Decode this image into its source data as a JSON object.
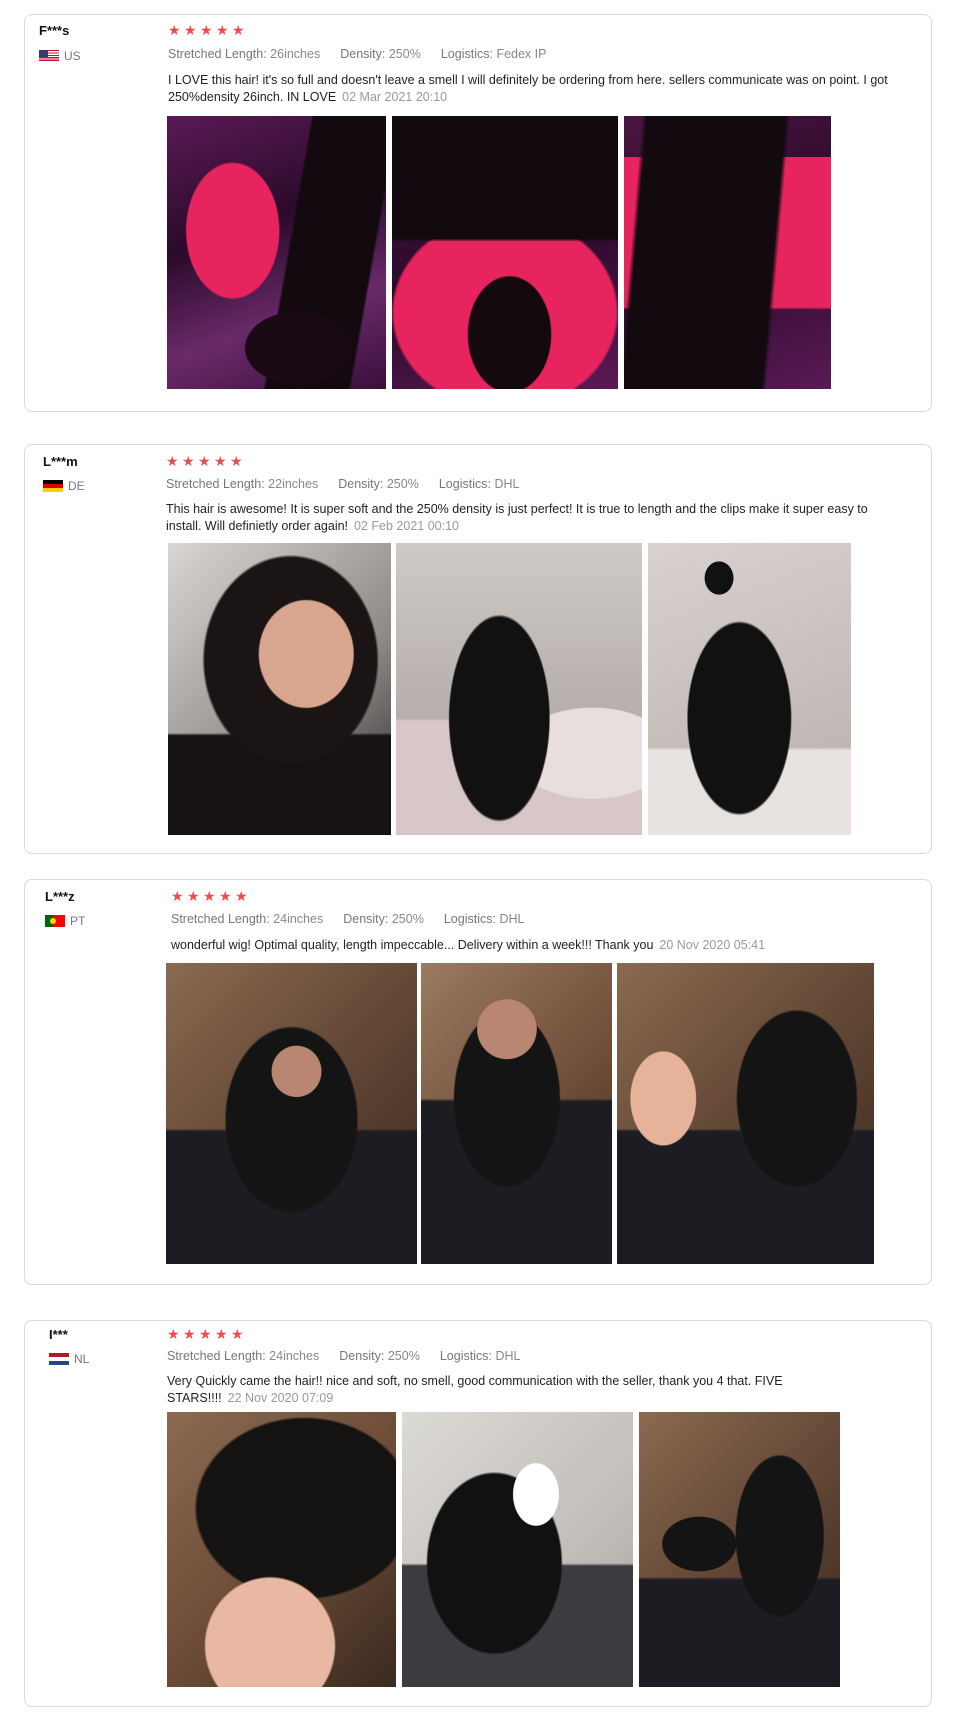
{
  "reviews": [
    {
      "user": "F***s",
      "country": "US",
      "flag": "us-flag-icon",
      "rating": 5,
      "attributes": [
        {
          "label": "Stretched Length:",
          "value": "26inches"
        },
        {
          "label": "Density:",
          "value": "250%"
        },
        {
          "label": "Logistics:",
          "value": "Fedex IP"
        }
      ],
      "text": "I LOVE this hair! it's so full and doesn't leave a smell I will definitely be ordering from here. sellers communicate was on point. I got 250%density 26inch. IN LOVE",
      "date": "02 Mar 2021 20:10",
      "photos": [
        "hair-bundle-photo",
        "hair-bundle-photo",
        "hair-bundle-photo"
      ]
    },
    {
      "user": "L***m",
      "country": "DE",
      "flag": "de-flag-icon",
      "rating": 5,
      "attributes": [
        {
          "label": "Stretched Length:",
          "value": "22inches"
        },
        {
          "label": "Density:",
          "value": "250%"
        },
        {
          "label": "Logistics:",
          "value": "DHL"
        }
      ],
      "text": "This hair is awesome! It is super soft and the 250% density is just perfect! It is true to length and the clips make it super easy to install. Will definietly order again!",
      "date": "02 Feb 2021 00:10",
      "photos": [
        "customer-photo",
        "customer-photo",
        "customer-photo"
      ]
    },
    {
      "user": "L***z",
      "country": "PT",
      "flag": "pt-flag-icon",
      "rating": 5,
      "attributes": [
        {
          "label": "Stretched Length:",
          "value": "24inches"
        },
        {
          "label": "Density:",
          "value": "250%"
        },
        {
          "label": "Logistics:",
          "value": "DHL"
        }
      ],
      "text": "wonderful wig! Optimal quality, length impeccable... Delivery within a week!!! Thank you",
      "date": "20 Nov 2020 05:41",
      "photos": [
        "customer-photo",
        "customer-photo",
        "customer-photo"
      ]
    },
    {
      "user": "I***",
      "country": "NL",
      "flag": "nl-flag-icon",
      "rating": 5,
      "attributes": [
        {
          "label": "Stretched Length:",
          "value": "24inches"
        },
        {
          "label": "Density:",
          "value": "250%"
        },
        {
          "label": "Logistics:",
          "value": "DHL"
        }
      ],
      "text": "Very Quickly came the hair!! nice and soft, no smell, good communication with the seller, thank you 4 that. FIVE STARS!!!!",
      "date": "22 Nov 2020 07:09",
      "photos": [
        "customer-photo",
        "customer-photo",
        "customer-photo"
      ]
    }
  ],
  "colors": {
    "star": "#f04a4a",
    "border": "#d9d9d9",
    "muted": "#888888",
    "bag_pink": "#e8245f",
    "velvet_purple": "#4a1540"
  }
}
